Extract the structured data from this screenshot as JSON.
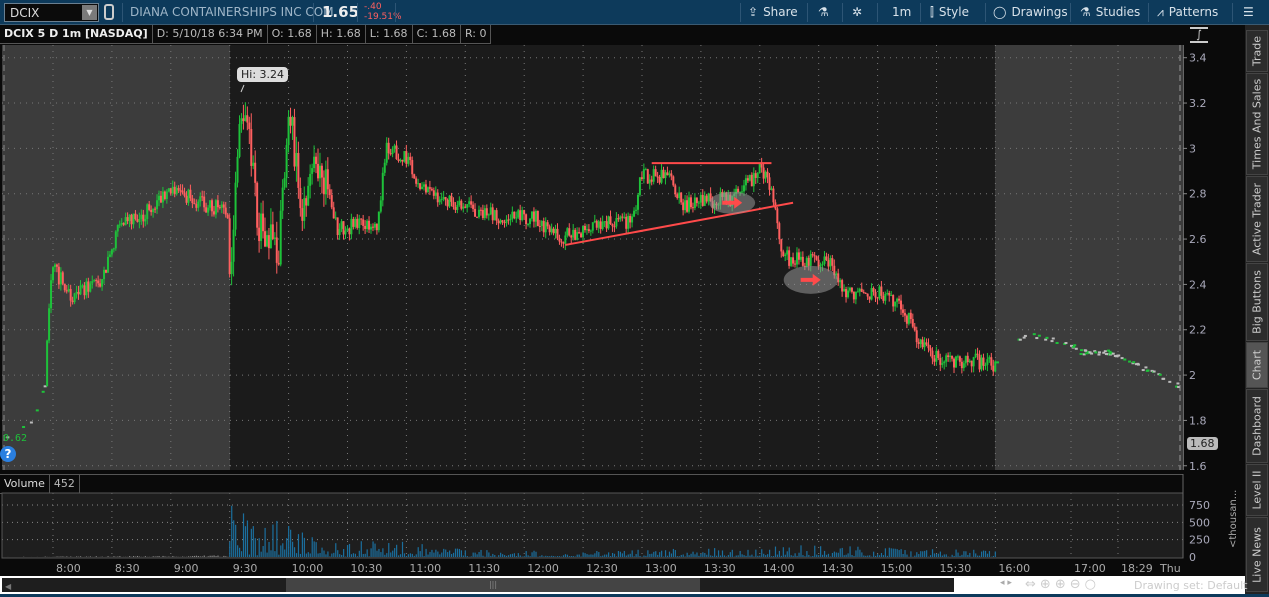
{
  "topbar": {
    "symbol": "DCIX",
    "company": "DIANA CONTAINERSHIPS INC COM",
    "last": "1.65",
    "change": "-.40",
    "change_pct": "-19.51%",
    "share": "Share",
    "timeframe": "1m",
    "style": "Style",
    "drawings": "Drawings",
    "studies": "Studies",
    "patterns": "Patterns"
  },
  "infobar": {
    "title": "DCIX 5 D 1m [NASDAQ]",
    "date": "D: 5/10/18 6:34 PM",
    "open": "O: 1.68",
    "high": "H: 1.68",
    "low": "L: 1.68",
    "close": "C: 1.68",
    "range": "R: 0"
  },
  "sidebar": {
    "tabs": [
      "Trade",
      "Times And Sales",
      "Active Trader",
      "Big Buttons",
      "Chart",
      "Dashboard",
      "Level II",
      "Live News"
    ]
  },
  "volume": {
    "label": "Volume",
    "value": "452",
    "unit": "<thousan..."
  },
  "bottom": {
    "drawing_set": "Drawing set: Default"
  },
  "colors": {
    "up": "#1ec23a",
    "down": "#ff5f5f",
    "volume": "#1b6f9e",
    "annotation": "#ff4a4a"
  },
  "chart_data": {
    "type": "candlestick",
    "price_ticks": [
      "3.4",
      "3.2",
      "3",
      "2.8",
      "2.6",
      "2.4",
      "2.2",
      "2",
      "1.8",
      "1.6"
    ],
    "ylim": [
      1.6,
      3.4
    ],
    "time_ticks": [
      "8:00",
      "8:30",
      "9:00",
      "9:30",
      "10:00",
      "10:30",
      "11:00",
      "11:30",
      "12:00",
      "12:30",
      "13:00",
      "13:30",
      "14:00",
      "14:30",
      "15:00",
      "15:30",
      "16:00",
      "17:00",
      "18:29",
      "Thu"
    ],
    "volume_ticks": [
      "750",
      "500",
      "250",
      "0"
    ],
    "volume_ylim": [
      0,
      900
    ],
    "hi_label": "Hi: 3.24",
    "left_label": "0.62",
    "current_price": "1.68",
    "price_path": [
      [
        "07:36",
        1.72
      ],
      [
        "07:50",
        1.8
      ],
      [
        "07:56",
        1.95
      ],
      [
        "07:58",
        2.3
      ],
      [
        "08:00",
        2.47
      ],
      [
        "08:10",
        2.35
      ],
      [
        "08:25",
        2.42
      ],
      [
        "08:33",
        2.65
      ],
      [
        "08:45",
        2.7
      ],
      [
        "09:00",
        2.82
      ],
      [
        "09:15",
        2.76
      ],
      [
        "09:29",
        2.72
      ],
      [
        "09:30",
        2.45
      ],
      [
        "09:35",
        3.05
      ],
      [
        "09:38",
        3.2
      ],
      [
        "09:45",
        2.65
      ],
      [
        "09:55",
        2.55
      ],
      [
        "09:59",
        2.95
      ],
      [
        "10:01",
        3.18
      ],
      [
        "10:06",
        2.75
      ],
      [
        "10:16",
        2.95
      ],
      [
        "10:25",
        2.65
      ],
      [
        "10:45",
        2.67
      ],
      [
        "10:50",
        3.0
      ],
      [
        "11:00",
        2.95
      ],
      [
        "11:10",
        2.8
      ],
      [
        "11:30",
        2.75
      ],
      [
        "11:45",
        2.7
      ],
      [
        "12:05",
        2.7
      ],
      [
        "12:18",
        2.6
      ],
      [
        "12:35",
        2.66
      ],
      [
        "12:55",
        2.68
      ],
      [
        "13:00",
        2.88
      ],
      [
        "13:15",
        2.88
      ],
      [
        "13:20",
        2.75
      ],
      [
        "13:45",
        2.78
      ],
      [
        "14:00",
        2.9
      ],
      [
        "14:05",
        2.85
      ],
      [
        "14:12",
        2.52
      ],
      [
        "14:25",
        2.5
      ],
      [
        "14:35",
        2.5
      ],
      [
        "14:45",
        2.36
      ],
      [
        "15:00",
        2.37
      ],
      [
        "15:12",
        2.3
      ],
      [
        "15:22",
        2.15
      ],
      [
        "15:32",
        2.06
      ],
      [
        "15:50",
        2.06
      ],
      [
        "15:59",
        2.05
      ],
      [
        "16:10",
        2.1
      ],
      [
        "16:25",
        2.18
      ],
      [
        "16:50",
        2.15
      ],
      [
        "17:20",
        2.1
      ],
      [
        "18:10",
        2.1
      ],
      [
        "18:40",
        2.07
      ],
      [
        "19:59",
        1.95
      ]
    ],
    "volume_profile": [
      [
        "07:36",
        2
      ],
      [
        "09:29",
        15
      ],
      [
        "09:30",
        550
      ],
      [
        "09:45",
        250
      ],
      [
        "10:00",
        420
      ],
      [
        "10:15",
        120
      ],
      [
        "10:50",
        160
      ],
      [
        "11:30",
        70
      ],
      [
        "12:30",
        50
      ],
      [
        "13:00",
        70
      ],
      [
        "14:00",
        90
      ],
      [
        "14:20",
        120
      ],
      [
        "15:00",
        90
      ],
      [
        "15:59",
        60
      ]
    ],
    "annotations": [
      {
        "type": "horizontal",
        "from": "13:05",
        "to": "14:06",
        "price": 2.935
      },
      {
        "type": "trendline",
        "from": [
          "12:21",
          2.574
        ],
        "to": [
          "14:17",
          2.76
        ]
      },
      {
        "type": "ellipse-arrow",
        "at": [
          "13:46",
          2.76
        ]
      },
      {
        "type": "ellipse-arrow",
        "at": [
          "14:26",
          2.42
        ]
      }
    ]
  }
}
